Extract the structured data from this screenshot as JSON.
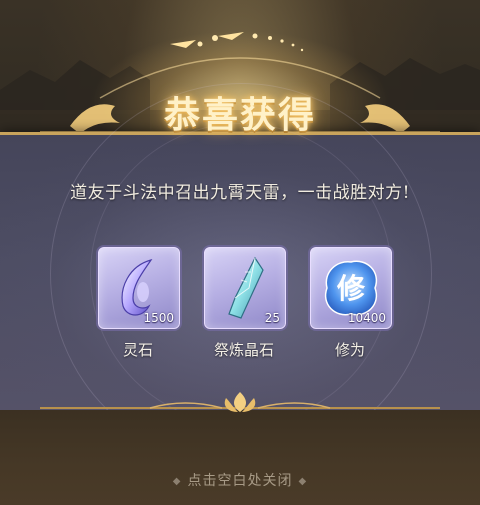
{
  "popup": {
    "title": "恭喜获得",
    "message": "道友于斗法中召出九霄天雷，一击战胜对方!",
    "close_hint": "点击空白处关闭",
    "close_hint_decoration": "◆"
  },
  "rewards": [
    {
      "name": "灵石",
      "count": "1500",
      "icon": "spirit-stone-icon",
      "color": "#8f88d8"
    },
    {
      "name": "祭炼晶石",
      "count": "25",
      "icon": "refining-crystal-icon",
      "color": "#8fd6d6"
    },
    {
      "name": "修为",
      "count": "10400",
      "icon": "cultivation-icon",
      "color": "#3f7fe0"
    }
  ],
  "colors": {
    "title_glow": "#f7c76a",
    "panel": "#4d4d63",
    "gold_border": "#c9a45c"
  }
}
